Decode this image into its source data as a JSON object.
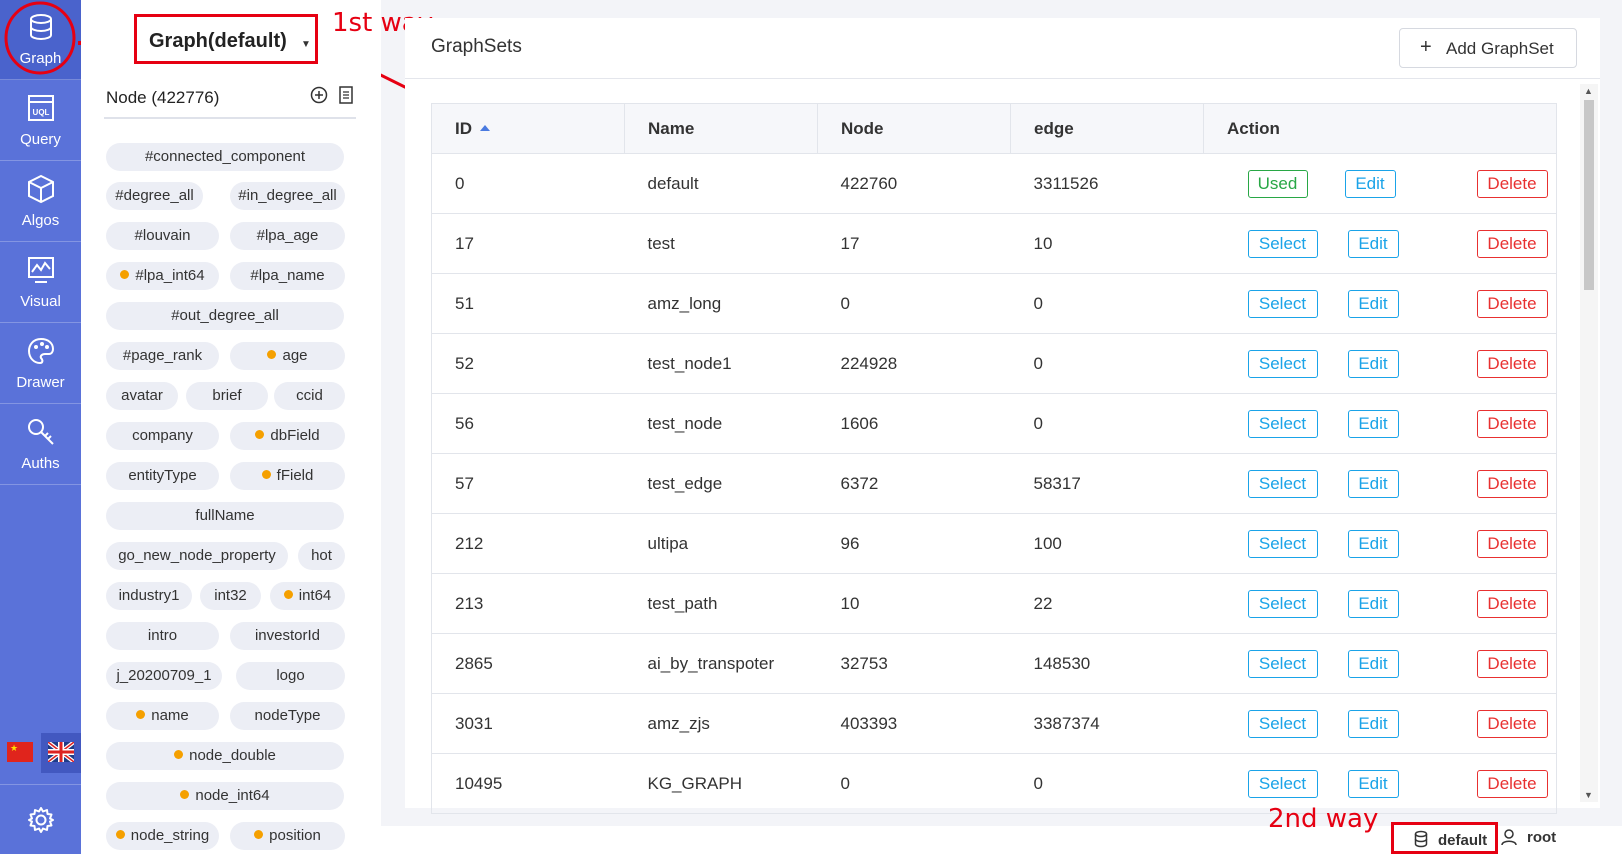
{
  "nav": {
    "items": [
      {
        "label": "Graph",
        "icon": "database-icon"
      },
      {
        "label": "Query",
        "icon": "uql-icon"
      },
      {
        "label": "Algos",
        "icon": "cube-icon"
      },
      {
        "label": "Visual",
        "icon": "chart-monitor-icon"
      },
      {
        "label": "Drawer",
        "icon": "palette-icon"
      },
      {
        "label": "Auths",
        "icon": "key-icon"
      }
    ],
    "languages": [
      "cn-flag-icon",
      "uk-flag-icon"
    ],
    "settings_icon": "gear-icon"
  },
  "graph_selector": {
    "value": "Graph(default)"
  },
  "annotations": {
    "first": "1st way",
    "second": "2nd way"
  },
  "side": {
    "node_title": "Node (422776)",
    "tags": [
      {
        "label": "#connected_component",
        "dot": false
      },
      {
        "label": "#degree_all",
        "dot": false
      },
      {
        "label": "#in_degree_all",
        "dot": false
      },
      {
        "label": "#louvain",
        "dot": false
      },
      {
        "label": "#lpa_age",
        "dot": false
      },
      {
        "label": "#lpa_int64",
        "dot": true
      },
      {
        "label": "#lpa_name",
        "dot": false
      },
      {
        "label": "#out_degree_all",
        "dot": false
      },
      {
        "label": "#page_rank",
        "dot": false
      },
      {
        "label": "age",
        "dot": true
      },
      {
        "label": "avatar",
        "dot": false
      },
      {
        "label": "brief",
        "dot": false
      },
      {
        "label": "ccid",
        "dot": false
      },
      {
        "label": "company",
        "dot": false
      },
      {
        "label": "dbField",
        "dot": true
      },
      {
        "label": "entityType",
        "dot": false
      },
      {
        "label": "fField",
        "dot": true
      },
      {
        "label": "fullName",
        "dot": false
      },
      {
        "label": "go_new_node_property",
        "dot": false
      },
      {
        "label": "hot",
        "dot": false
      },
      {
        "label": "industry1",
        "dot": false
      },
      {
        "label": "int32",
        "dot": false
      },
      {
        "label": "int64",
        "dot": true
      },
      {
        "label": "intro",
        "dot": false
      },
      {
        "label": "investorId",
        "dot": false
      },
      {
        "label": "j_20200709_1",
        "dot": false
      },
      {
        "label": "logo",
        "dot": false
      },
      {
        "label": "name",
        "dot": true
      },
      {
        "label": "nodeType",
        "dot": false
      },
      {
        "label": "node_double",
        "dot": true
      },
      {
        "label": "node_int64",
        "dot": true
      },
      {
        "label": "node_string",
        "dot": true
      },
      {
        "label": "position",
        "dot": true
      }
    ]
  },
  "main": {
    "title": "GraphSets",
    "add_button": "Add GraphSet",
    "columns": [
      "ID",
      "Name",
      "Node",
      "edge",
      "Action"
    ],
    "rows": [
      {
        "id": "0",
        "name": "default",
        "node": "422760",
        "edge": "3311526",
        "state": "Used"
      },
      {
        "id": "17",
        "name": "test",
        "node": "17",
        "edge": "10",
        "state": "Select"
      },
      {
        "id": "51",
        "name": "amz_long",
        "node": "0",
        "edge": "0",
        "state": "Select"
      },
      {
        "id": "52",
        "name": "test_node1",
        "node": "224928",
        "edge": "0",
        "state": "Select"
      },
      {
        "id": "56",
        "name": "test_node",
        "node": "1606",
        "edge": "0",
        "state": "Select"
      },
      {
        "id": "57",
        "name": "test_edge",
        "node": "6372",
        "edge": "58317",
        "state": "Select"
      },
      {
        "id": "212",
        "name": "ultipa",
        "node": "96",
        "edge": "100",
        "state": "Select"
      },
      {
        "id": "213",
        "name": "test_path",
        "node": "10",
        "edge": "22",
        "state": "Select"
      },
      {
        "id": "2865",
        "name": "ai_by_transpoter",
        "node": "32753",
        "edge": "148530",
        "state": "Select"
      },
      {
        "id": "3031",
        "name": "amz_zjs",
        "node": "403393",
        "edge": "3387374",
        "state": "Select"
      },
      {
        "id": "10495",
        "name": "KG_GRAPH",
        "node": "0",
        "edge": "0",
        "state": "Select"
      }
    ],
    "edit_label": "Edit",
    "delete_label": "Delete"
  },
  "status_bar": {
    "graph": "default",
    "user": "root"
  },
  "colors": {
    "nav": "#5a72d9",
    "annotation": "#e60012",
    "select": "#1aa3e8",
    "used": "#28a745",
    "delete": "#e83030",
    "dot": "#f5a000"
  }
}
